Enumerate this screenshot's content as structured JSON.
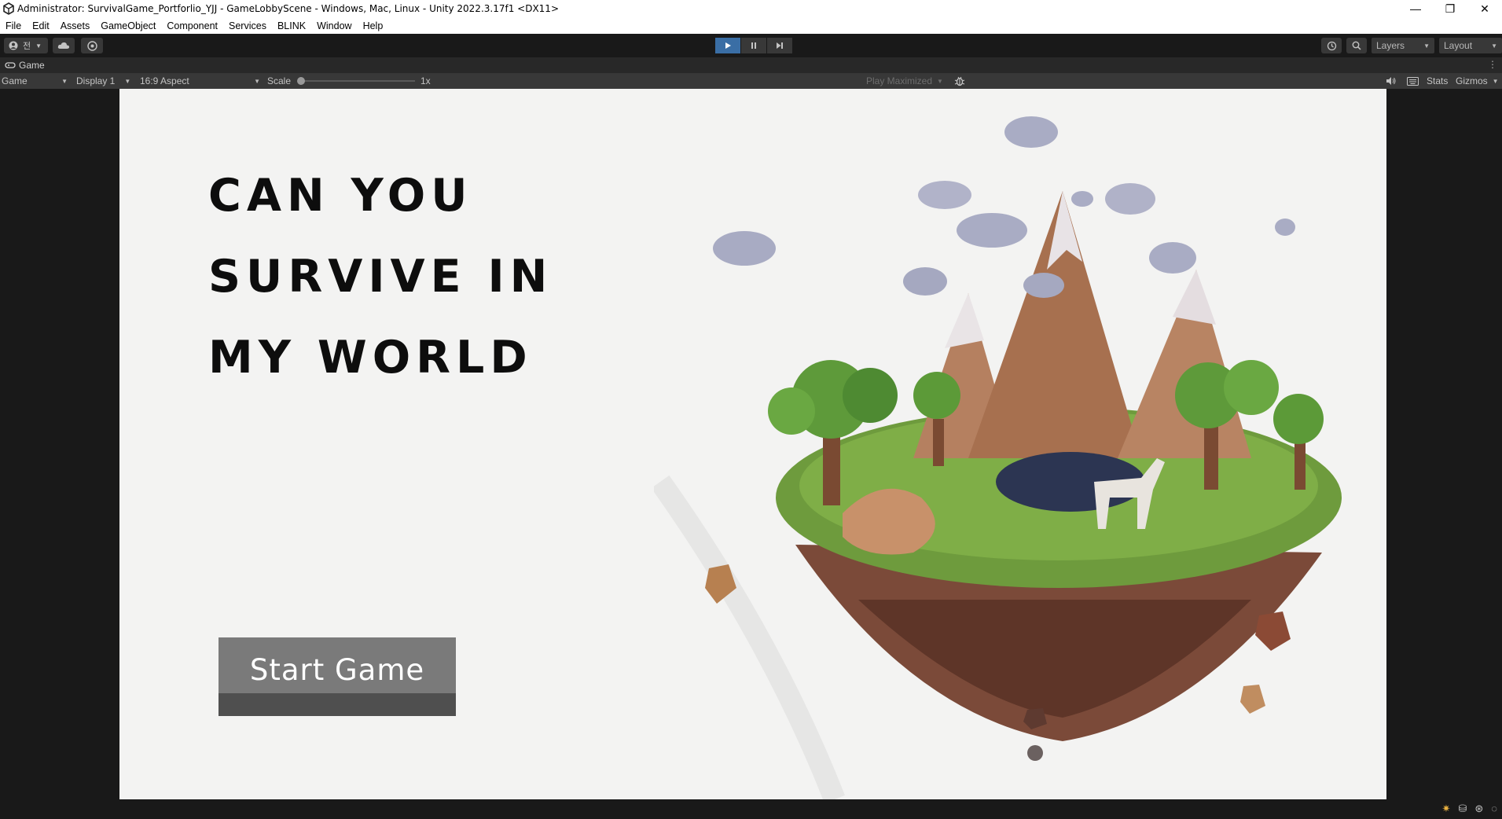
{
  "window": {
    "title": "Administrator: SurvivalGame_Portforlio_YJJ - GameLobbyScene - Windows, Mac, Linux - Unity 2022.3.17f1 <DX11>",
    "controls": {
      "minimize": "—",
      "restore": "❐",
      "close": "✕"
    }
  },
  "menu": {
    "items": [
      "File",
      "Edit",
      "Assets",
      "GameObject",
      "Component",
      "Services",
      "BLINK",
      "Window",
      "Help"
    ]
  },
  "toolbar": {
    "account_label": "전",
    "layers_label": "Layers",
    "layout_label": "Layout",
    "play_active": true,
    "accent_color": "#3a6ea5"
  },
  "tab": {
    "label": "Game"
  },
  "game_bar": {
    "view_select": "Game",
    "display_select": "Display 1",
    "aspect_select": "16:9 Aspect",
    "scale_label": "Scale",
    "scale_value": "1x",
    "play_mode": "Play Maximized",
    "stats_label": "Stats",
    "gizmos_label": "Gizmos"
  },
  "game": {
    "headline": [
      "CAN YOU",
      "SURVIVE IN",
      "MY WORLD"
    ],
    "start_button": "Start Game",
    "background_color": "#f3f3f2"
  }
}
